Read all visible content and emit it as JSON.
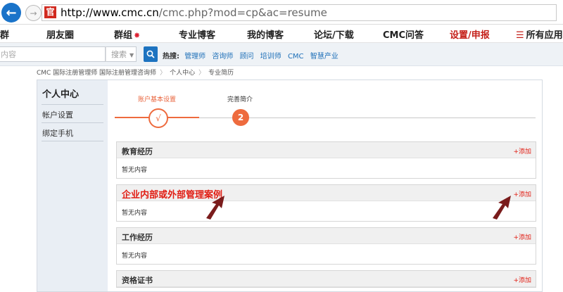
{
  "browser": {
    "url_host": "http://www.cmc.cn",
    "url_path": "/cmc.php?mod=cp&ac=resume",
    "favicon_char": "官"
  },
  "nav": {
    "items": [
      "群",
      "朋友圈",
      "群组",
      "专业博客",
      "我的博客",
      "论坛/下载",
      "CMC问答",
      "设置/申报",
      "所有应用"
    ]
  },
  "search": {
    "placeholder": "内容",
    "type_label": "搜索",
    "hot_label": "热搜:",
    "hot_keywords": [
      "管理师",
      "咨询师",
      "顾问",
      "培训师",
      "CMC",
      "智慧产业"
    ]
  },
  "breadcrumb": {
    "items": [
      "CMC 国际注册管理师 国际注册管理咨询师",
      "个人中心",
      "专业简历"
    ]
  },
  "sidebar": {
    "title": "个人中心",
    "items": [
      "帐户设置",
      "绑定手机"
    ]
  },
  "steps": {
    "step1_label": "账户基本设置",
    "step1_mark": "√",
    "step2_label": "完善简介",
    "step2_mark": "2"
  },
  "sections": [
    {
      "title": "教育经历",
      "add": "+添加",
      "empty": "暂无内容"
    },
    {
      "title": "企业内部或外部管理案例",
      "add": "+添加",
      "empty": "暂无内容"
    },
    {
      "title": "工作经历",
      "add": "+添加",
      "empty": "暂无内容"
    },
    {
      "title": "资格证书",
      "add": "+添加",
      "empty": ""
    }
  ],
  "colors": {
    "accent": "#ee6b3e",
    "link": "#1d6fb8",
    "highlight": "#e11c12",
    "annotation": "#7a1c1c"
  }
}
